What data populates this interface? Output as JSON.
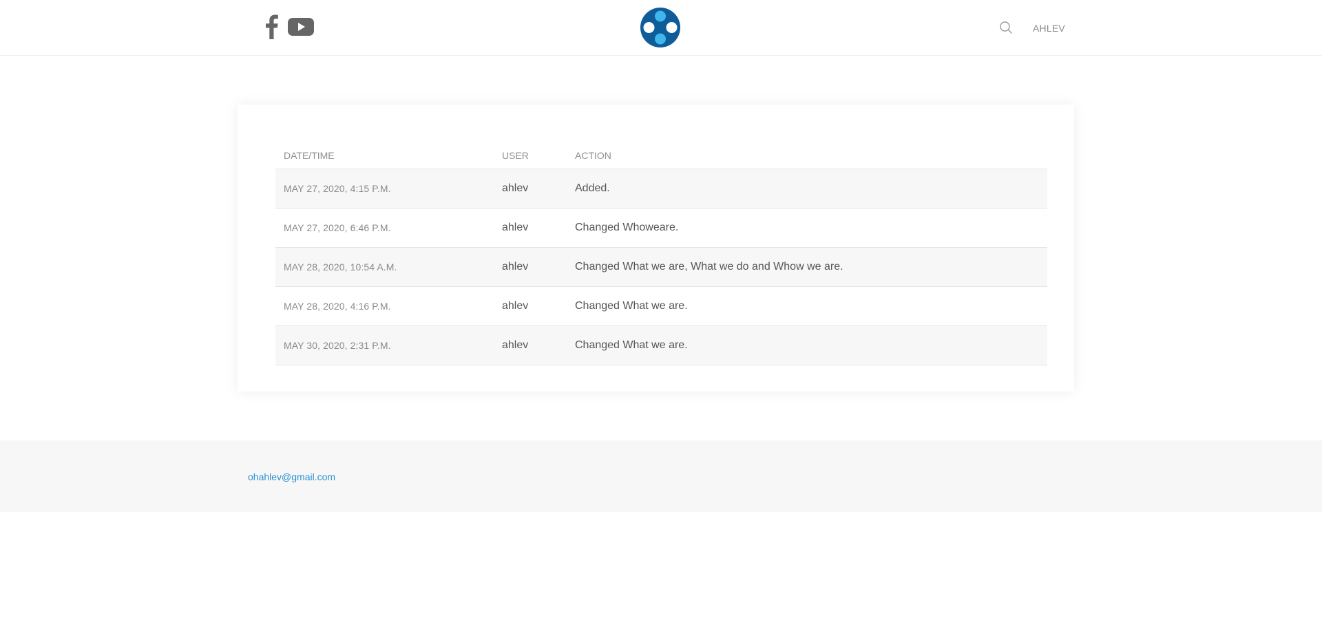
{
  "header": {
    "social": [
      {
        "name": "facebook-icon"
      },
      {
        "name": "youtube-icon"
      }
    ],
    "logo": "logo-icon",
    "search_icon": "search-icon",
    "user_label": "AHLEV"
  },
  "history": {
    "columns": {
      "date": "DATE/TIME",
      "user": "USER",
      "action": "ACTION"
    },
    "rows": [
      {
        "date": "MAY 27, 2020, 4:15 P.M.",
        "user": "ahlev",
        "action": "Added."
      },
      {
        "date": "MAY 27, 2020, 6:46 P.M.",
        "user": "ahlev",
        "action": "Changed Whoweare."
      },
      {
        "date": "MAY 28, 2020, 10:54 A.M.",
        "user": "ahlev",
        "action": "Changed What we are, What we do and Whow we are."
      },
      {
        "date": "MAY 28, 2020, 4:16 P.M.",
        "user": "ahlev",
        "action": "Changed What we are."
      },
      {
        "date": "MAY 30, 2020, 2:31 P.M.",
        "user": "ahlev",
        "action": "Changed What we are."
      }
    ]
  },
  "footer": {
    "email": "ohahlev@gmail.com"
  },
  "colors": {
    "logo_dark": "#0e5c99",
    "logo_light": "#3fb6ec",
    "link": "#2a8fd6",
    "icon_gray": "#666666"
  }
}
